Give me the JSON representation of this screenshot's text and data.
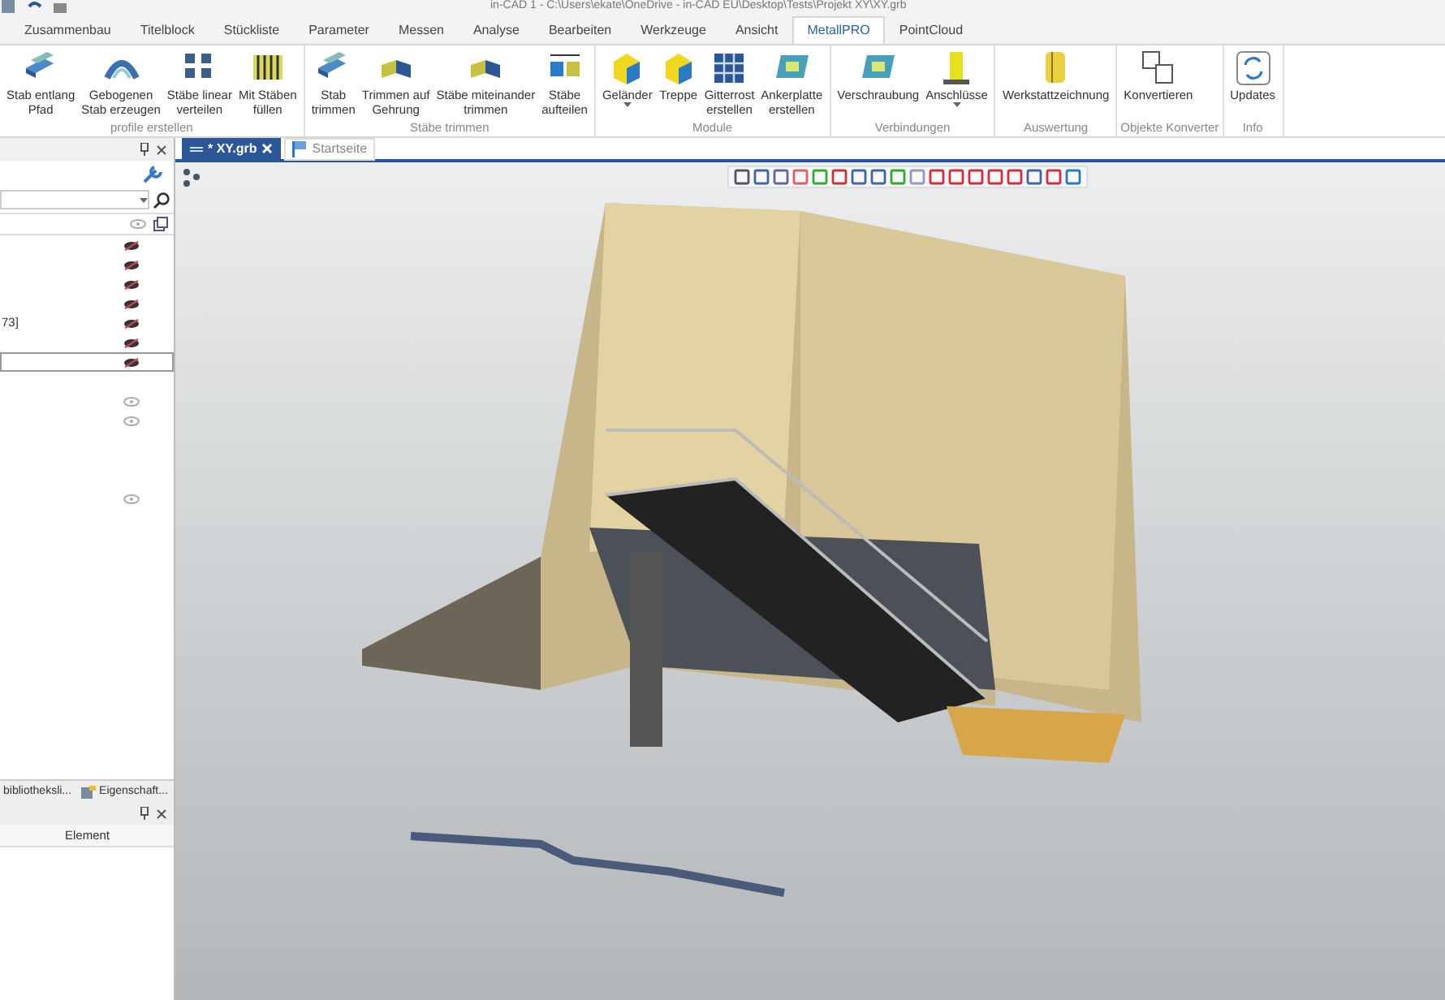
{
  "window": {
    "title": "in-CAD 1 - C:\\Users\\ekate\\OneDrive - in-CAD EU\\Desktop\\Tests\\Projekt XY\\XY.grb"
  },
  "ribbon_tabs": [
    {
      "label": "Zusammenbau",
      "selected": false
    },
    {
      "label": "Titelblock",
      "selected": false
    },
    {
      "label": "Stückliste",
      "selected": false
    },
    {
      "label": "Parameter",
      "selected": false
    },
    {
      "label": "Messen",
      "selected": false
    },
    {
      "label": "Analyse",
      "selected": false
    },
    {
      "label": "Bearbeiten",
      "selected": false
    },
    {
      "label": "Werkzeuge",
      "selected": false
    },
    {
      "label": "Ansicht",
      "selected": false
    },
    {
      "label": "MetallPRO",
      "selected": true
    },
    {
      "label": "PointCloud",
      "selected": false
    }
  ],
  "ribbon_groups": [
    {
      "label": "profile erstellen",
      "buttons": [
        {
          "label": "Stab entlang\nPfad"
        },
        {
          "label": "Gebogenen\nStab erzeugen"
        },
        {
          "label": "Stäbe linear\nverteilen"
        },
        {
          "label": "Mit Stäben\nfüllen"
        }
      ]
    },
    {
      "label": "Stäbe trimmen",
      "buttons": [
        {
          "label": "Stab\ntrimmen"
        },
        {
          "label": "Trimmen auf\nGehrung"
        },
        {
          "label": "Stäbe miteinander\ntrimmen"
        },
        {
          "label": "Stäbe\naufteilen"
        }
      ]
    },
    {
      "label": "Module",
      "buttons": [
        {
          "label": "Geländer",
          "has_menu": true
        },
        {
          "label": "Treppe"
        },
        {
          "label": "Gitterrost\nerstellen"
        },
        {
          "label": "Ankerplatte\nerstellen"
        }
      ]
    },
    {
      "label": "Verbindungen",
      "buttons": [
        {
          "label": "Verschraubung"
        },
        {
          "label": "Anschlüsse",
          "has_menu": true
        }
      ]
    },
    {
      "label": "Auswertung",
      "buttons": [
        {
          "label": "Werkstattzeichnung"
        }
      ]
    },
    {
      "label": "Objekte Konverter",
      "buttons": [
        {
          "label": "Konvertieren"
        }
      ]
    },
    {
      "label": "Info",
      "buttons": [
        {
          "label": "Updates"
        }
      ]
    }
  ],
  "document_tabs": [
    {
      "label": "* XY.grb",
      "selected": true
    },
    {
      "label": "Startseite",
      "selected": false
    }
  ],
  "tree_rows": [
    {
      "hidden": true,
      "selected": false
    },
    {
      "hidden": true,
      "selected": false
    },
    {
      "hidden": true,
      "selected": false
    },
    {
      "hidden": true,
      "selected": false
    },
    {
      "label": "73]",
      "hidden": true,
      "selected": false
    },
    {
      "hidden": true,
      "selected": false
    },
    {
      "hidden": true,
      "selected": true
    },
    {
      "hidden": false,
      "selected": false
    },
    {
      "hidden": false,
      "selected": false
    },
    {
      "hidden": false,
      "selected": false
    }
  ],
  "panel_tabs": [
    {
      "label": "bibliotheksli...",
      "selected": false
    },
    {
      "label": "Eigenschaft...",
      "selected": false
    }
  ],
  "properties_panel": {
    "columns": [
      "Element"
    ]
  }
}
